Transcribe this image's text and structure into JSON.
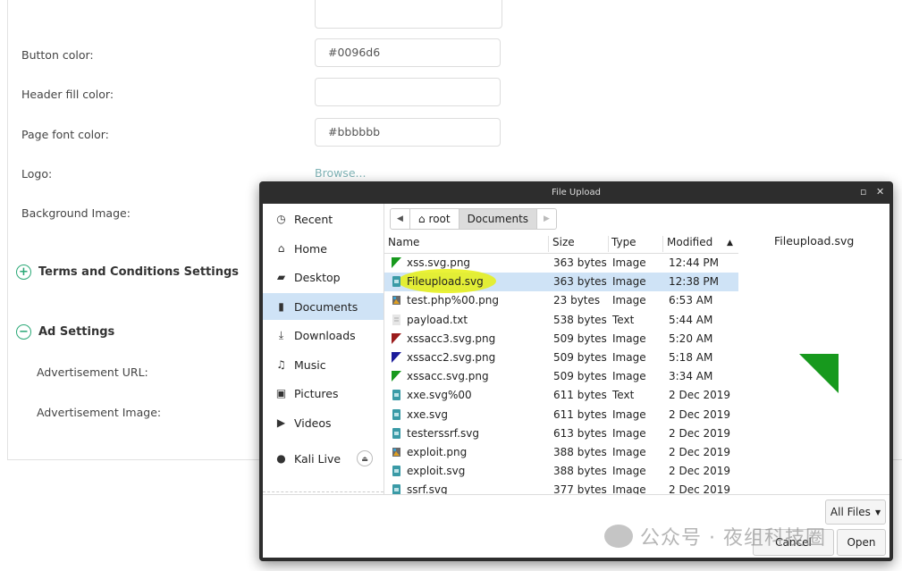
{
  "settings": {
    "fields": [
      {
        "label": "Button color:",
        "value": "#0096d6"
      },
      {
        "label": "Header fill color:",
        "value": ""
      },
      {
        "label": "Page font color:",
        "value": "#bbbbbb"
      }
    ],
    "logo_label": "Logo:",
    "browse_label": "Browse...",
    "background_label": "Background Image:",
    "terms_section": "Terms and Conditions Settings",
    "ad_section": "Ad Settings",
    "ad_url_label": "Advertisement URL:",
    "ad_image_label": "Advertisement Image:",
    "accent_color": "#2aa876"
  },
  "dialog": {
    "title": "File Upload",
    "places": [
      {
        "label": "Recent",
        "icon": "clock-icon"
      },
      {
        "label": "Home",
        "icon": "home-icon"
      },
      {
        "label": "Desktop",
        "icon": "desktop-icon"
      },
      {
        "label": "Documents",
        "icon": "folder-icon",
        "selected": true
      },
      {
        "label": "Downloads",
        "icon": "download-icon"
      },
      {
        "label": "Music",
        "icon": "music-icon"
      },
      {
        "label": "Pictures",
        "icon": "pictures-icon"
      },
      {
        "label": "Videos",
        "icon": "video-icon"
      },
      {
        "label": "Kali Live",
        "icon": "disc-icon"
      }
    ],
    "path": [
      "root",
      "Documents"
    ],
    "columns": {
      "name": "Name",
      "size": "Size",
      "type": "Type",
      "modified": "Modified"
    },
    "files": [
      {
        "name": "xss.svg.png",
        "size": "363 bytes",
        "type": "Image",
        "modified": "12:44 PM",
        "icon": "image-green-icon"
      },
      {
        "name": "Fileupload.svg",
        "size": "363 bytes",
        "type": "Image",
        "modified": "12:38 PM",
        "icon": "svg-file-icon",
        "selected": true
      },
      {
        "name": "test.php%00.png",
        "size": "23 bytes",
        "type": "Image",
        "modified": "6:53 AM",
        "icon": "image-file-icon"
      },
      {
        "name": "payload.txt",
        "size": "538 bytes",
        "type": "Text",
        "modified": "5:44 AM",
        "icon": "text-file-icon"
      },
      {
        "name": "xssacc3.svg.png",
        "size": "509 bytes",
        "type": "Image",
        "modified": "5:20 AM",
        "icon": "image-red-icon"
      },
      {
        "name": "xssacc2.svg.png",
        "size": "509 bytes",
        "type": "Image",
        "modified": "5:18 AM",
        "icon": "image-blue-icon"
      },
      {
        "name": "xssacc.svg.png",
        "size": "509 bytes",
        "type": "Image",
        "modified": "3:34 AM",
        "icon": "image-green-icon"
      },
      {
        "name": "xxe.svg%00",
        "size": "611 bytes",
        "type": "Text",
        "modified": "2 Dec 2019",
        "icon": "svg-file-icon"
      },
      {
        "name": "xxe.svg",
        "size": "611 bytes",
        "type": "Image",
        "modified": "2 Dec 2019",
        "icon": "svg-file-icon"
      },
      {
        "name": "testerssrf.svg",
        "size": "613 bytes",
        "type": "Image",
        "modified": "2 Dec 2019",
        "icon": "svg-file-icon"
      },
      {
        "name": "exploit.png",
        "size": "388 bytes",
        "type": "Image",
        "modified": "2 Dec 2019",
        "icon": "image-file-icon"
      },
      {
        "name": "exploit.svg",
        "size": "388 bytes",
        "type": "Image",
        "modified": "2 Dec 2019",
        "icon": "svg-file-icon"
      },
      {
        "name": "ssrf.svg",
        "size": "377 bytes",
        "type": "Image",
        "modified": "2 Dec 2019",
        "icon": "svg-file-icon"
      }
    ],
    "preview_name": "Fileupload.svg",
    "filter": "All Files",
    "cancel": "Cancel",
    "open": "Open"
  },
  "watermark": "公众号 · 夜组科技圈"
}
